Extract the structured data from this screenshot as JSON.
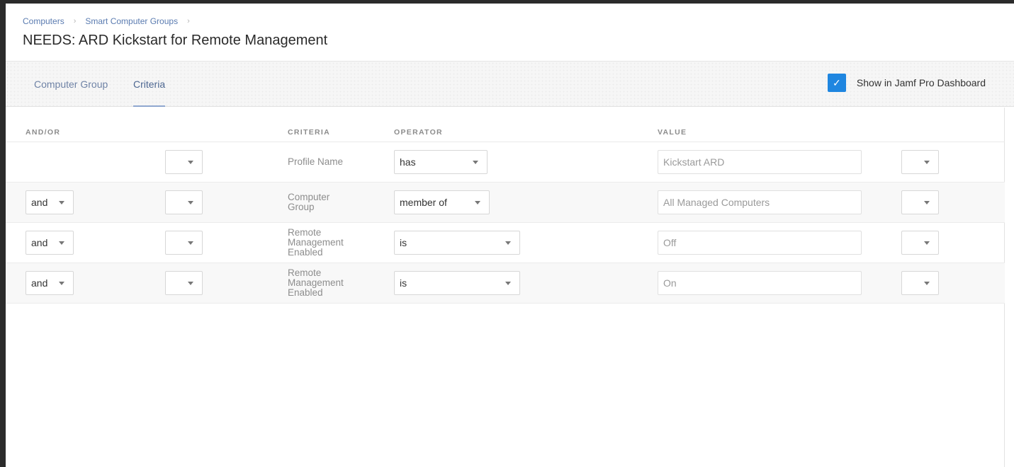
{
  "breadcrumb": {
    "items": [
      "Computers",
      "Smart Computer Groups"
    ]
  },
  "page_title": "NEEDS: ARD Kickstart for Remote Management",
  "tabs": [
    {
      "label": "Computer Group",
      "active": false
    },
    {
      "label": "Criteria",
      "active": true
    }
  ],
  "dashboard": {
    "label": "Show in Jamf Pro Dashboard",
    "checked": true,
    "check_icon": "checkmark-icon"
  },
  "columns": {
    "andor": "AND/OR",
    "criteria": "CRITERIA",
    "operator": "OPERATOR",
    "value": "VALUE"
  },
  "rows": [
    {
      "andor": "",
      "paren_open": "",
      "criteria": "Profile Name",
      "operator": "has",
      "value": "Kickstart ARD",
      "paren_close": ""
    },
    {
      "andor": "and",
      "paren_open": "",
      "criteria": "Computer Group",
      "operator": "member of",
      "value": "All Managed Computers",
      "paren_close": ""
    },
    {
      "andor": "and",
      "paren_open": "",
      "criteria": "Remote Management Enabled",
      "operator": "is",
      "value": "Off",
      "paren_close": ""
    },
    {
      "andor": "and",
      "paren_open": "",
      "criteria": "Remote Management Enabled",
      "operator": "is",
      "value": "On",
      "paren_close": ""
    }
  ],
  "colors": {
    "accent": "#1f86e0",
    "link": "#5a7bb0",
    "tab_underline": "#8fa7cf"
  }
}
